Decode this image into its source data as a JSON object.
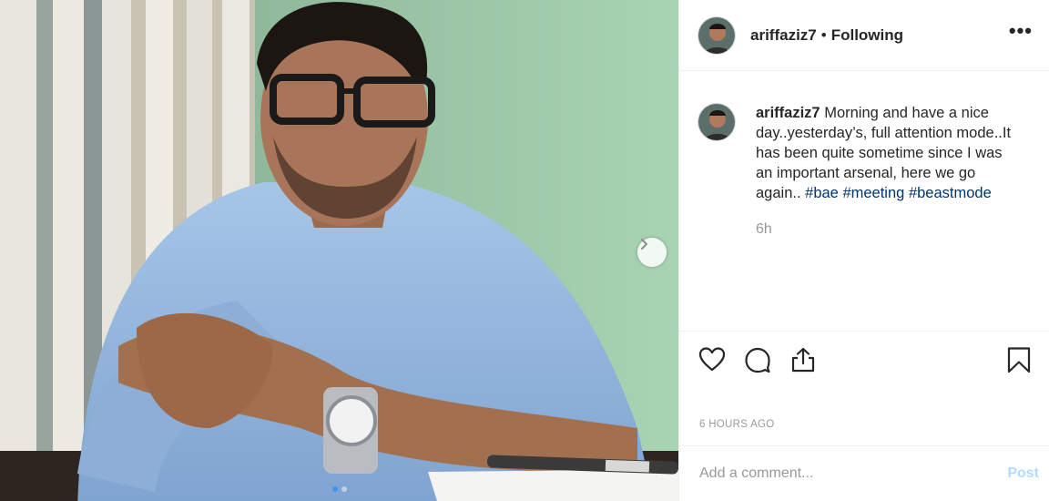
{
  "post": {
    "username": "ariffaziz7",
    "follow_separator": "•",
    "follow_status": "Following",
    "more_label": "•••",
    "caption": {
      "username": "ariffaziz7",
      "text": "Morning and have a nice day..yesterday’s, full attention mode..It has been quite sometime since I was an important arsenal, here we go again..",
      "hashtags": [
        "#bae",
        "#meeting",
        "#beastmode"
      ],
      "age": "6h"
    },
    "timestamp": "6 HOURS AGO",
    "carousel": {
      "total_images": 2,
      "active_index": 0
    }
  },
  "comment": {
    "placeholder": "Add a comment...",
    "post_label": "Post"
  },
  "colors": {
    "link": "#003569",
    "post_disabled": "#b3dbff",
    "active_dot": "#3897f0",
    "muted": "#999999"
  },
  "icons": {
    "actions": [
      "heart-icon",
      "comment-icon",
      "share-icon"
    ],
    "save": "bookmark-icon",
    "carousel_next": "chevron-right-icon"
  }
}
